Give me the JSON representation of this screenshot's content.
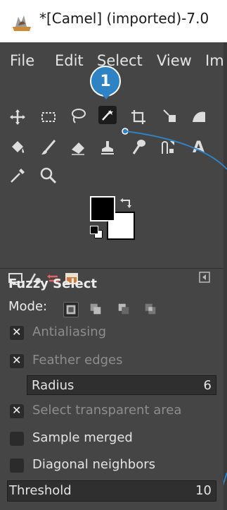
{
  "window": {
    "title": "*[Camel] (imported)-7.0"
  },
  "menu": [
    "File",
    "Edit",
    "Select",
    "View",
    "Ima"
  ],
  "callout": {
    "number": "1"
  },
  "tool_options": {
    "title": "Fuzzy Select",
    "mode_label": "Mode:",
    "antialiasing": {
      "label": "Antialiasing",
      "checked": true
    },
    "feather_edges": {
      "label": "Feather edges",
      "checked": true
    },
    "radius": {
      "label": "Radius",
      "value": "6"
    },
    "select_transparent": {
      "label": "Select transparent area",
      "checked": true
    },
    "sample_merged": {
      "label": "Sample merged",
      "checked": false
    },
    "diagonal_neighbors": {
      "label": "Diagonal neighbors",
      "checked": false
    },
    "threshold": {
      "label": "Threshold",
      "value": "10"
    }
  },
  "colors": {
    "accent": "#2f83c5",
    "foreground": "#000000",
    "background": "#ffffff"
  }
}
